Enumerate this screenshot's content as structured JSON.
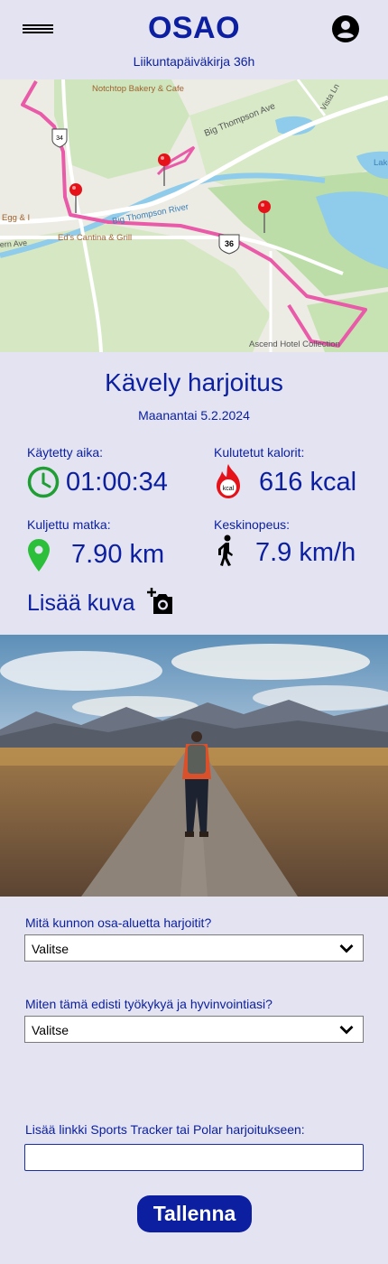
{
  "header": {
    "title": "OSAO",
    "subtitle": "Liikuntapäiväkirja 36h",
    "menu_icon": "hamburger-menu-icon",
    "profile_icon": "account-circle-icon"
  },
  "map": {
    "labels": {
      "bakery": "Notchtop Bakery & Cafe",
      "road": "Big Thompson Ave",
      "river": "Big Thompson River",
      "restaurant": "Ed's Cantina & Grill",
      "egg": "Egg & I",
      "hotel": "Ascend Hotel Collection",
      "vista": "Vista Ln",
      "lake": "Lake Estes",
      "route_shield_1": "34",
      "route_shield_2": "36",
      "street_left": "ern Ave"
    }
  },
  "workout": {
    "title": "Kävely harjoitus",
    "date": "Maanantai 5.2.2024"
  },
  "stats": {
    "time": {
      "label": "Käytetty aika:",
      "value": "01:00:34",
      "icon": "clock-icon"
    },
    "calories": {
      "label": "Kulutetut kalorit:",
      "value": "616 kcal",
      "icon": "flame-kcal-icon",
      "icon_text": "kcal"
    },
    "distance": {
      "label": "Kuljettu matka:",
      "value": "7.90 km",
      "icon": "location-pin-icon"
    },
    "speed": {
      "label": "Keskinopeus:",
      "value": "7.9 km/h",
      "icon": "walking-person-icon"
    }
  },
  "add_photo": {
    "label": "Lisää kuva",
    "icon": "add-photo-camera-icon"
  },
  "form": {
    "q1": {
      "label": "Mitä kunnon osa-aluetta harjoitit?",
      "value": "Valitse"
    },
    "q2": {
      "label": "Miten tämä edisti työkykyä ja hyvinvointiasi?",
      "value": "Valitse"
    },
    "link": {
      "label": "Lisää linkki Sports Tracker tai Polar harjoitukseen:",
      "value": ""
    },
    "save_label": "Tallenna"
  },
  "colors": {
    "background": "#e3e3f1",
    "accent": "#0b1fa0",
    "clock_green": "#1e9e33",
    "pin_green": "#2bbf3a",
    "flame_red": "#e5121a",
    "route_pink": "#e95aa8"
  }
}
